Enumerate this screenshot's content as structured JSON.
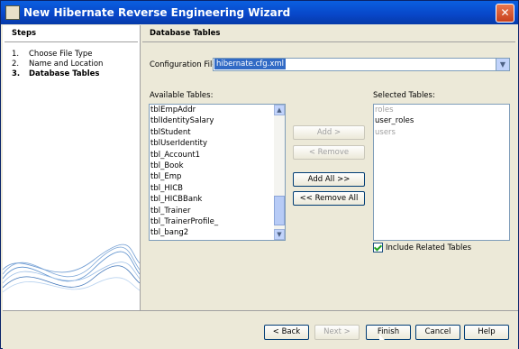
{
  "window": {
    "title": "New Hibernate Reverse Engineering Wizard",
    "close_glyph": "✕"
  },
  "steps": {
    "heading": "Steps",
    "items": [
      {
        "num": "1.",
        "label": "Choose File Type"
      },
      {
        "num": "2.",
        "label": "Name and Location"
      },
      {
        "num": "3.",
        "label": "Database Tables"
      }
    ]
  },
  "panel": {
    "heading": "Database Tables",
    "config_label": "Configuration File:",
    "config_value": "hibernate.cfg.xml",
    "available_label": "Available Tables:",
    "selected_label": "Selected Tables:",
    "available_tables": [
      "tblEmpAddr",
      "tblIdentitySalary",
      "tblStudent",
      "tblUserIdentity",
      "tbl_Account1",
      "tbl_Book",
      "tbl_Emp",
      "tbl_HICB",
      "tbl_HICBBank",
      "tbl_Trainer",
      "tbl_TrainerProfile_",
      "tbl_bang2"
    ],
    "selected_tables": [
      {
        "name": "roles",
        "dim": true
      },
      {
        "name": "user_roles",
        "dim": false
      },
      {
        "name": "users",
        "dim": true
      }
    ],
    "buttons": {
      "add": "Add >",
      "remove": "< Remove",
      "add_all": "Add All >>",
      "remove_all": "<< Remove All"
    },
    "include_related": "Include Related Tables"
  },
  "footer": {
    "back": "< Back",
    "next": "Next >",
    "finish": "Finish",
    "cancel": "Cancel",
    "help": "Help"
  }
}
